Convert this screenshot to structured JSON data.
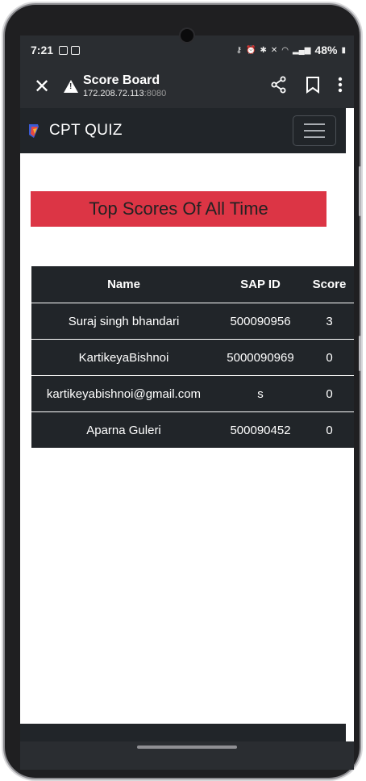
{
  "status": {
    "time": "7:21",
    "battery": "48%"
  },
  "browser": {
    "page_title": "Score Board",
    "host": "172.208.72.113",
    "port": ":8080"
  },
  "navbar": {
    "brand": "CPT QUIZ"
  },
  "main": {
    "heading": "Top Scores Of All Time",
    "accent_color": "#dc3545",
    "table": {
      "headers": [
        "Name",
        "SAP ID",
        "Score"
      ],
      "rows": [
        [
          "Suraj singh bhandari",
          "500090956",
          "3"
        ],
        [
          "KartikeyaBishnoi",
          "5000090969",
          "0"
        ],
        [
          "kartikeyabishnoi@gmail.com",
          "s",
          "0"
        ],
        [
          "Aparna Guleri",
          "500090452",
          "0"
        ]
      ]
    }
  },
  "icons": {
    "close": "close-icon",
    "warning": "warning-icon",
    "share": "share-icon",
    "bookmark": "bookmark-icon",
    "menu": "more-vertical-icon",
    "hamburger": "hamburger-icon"
  }
}
